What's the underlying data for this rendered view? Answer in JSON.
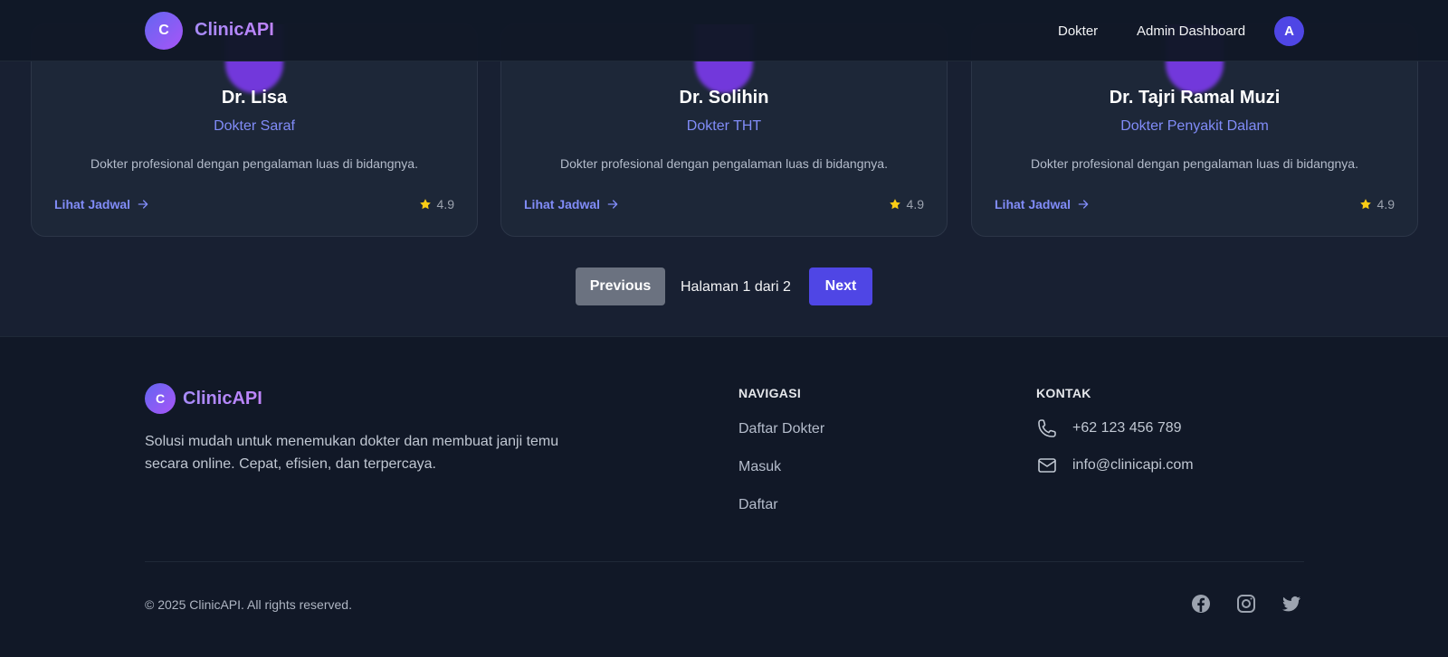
{
  "header": {
    "logo_letter": "C",
    "brand": "ClinicAPI",
    "nav": [
      "Dokter",
      "Admin Dashboard"
    ],
    "user_initial": "A"
  },
  "doctors": [
    {
      "name": "Dr. Lisa",
      "specialty": "Dokter Saraf",
      "description": "Dokter profesional dengan pengalaman luas di bidangnya.",
      "link": "Lihat Jadwal",
      "rating": "4.9"
    },
    {
      "name": "Dr. Solihin",
      "specialty": "Dokter THT",
      "description": "Dokter profesional dengan pengalaman luas di bidangnya.",
      "link": "Lihat Jadwal",
      "rating": "4.9"
    },
    {
      "name": "Dr. Tajri Ramal Muzi",
      "specialty": "Dokter Penyakit Dalam",
      "description": "Dokter profesional dengan pengalaman luas di bidangnya.",
      "link": "Lihat Jadwal",
      "rating": "4.9"
    }
  ],
  "pagination": {
    "previous": "Previous",
    "info": "Halaman 1 dari 2",
    "next": "Next"
  },
  "footer": {
    "logo_letter": "C",
    "brand": "ClinicAPI",
    "description": "Solusi mudah untuk menemukan dokter dan membuat janji temu secara online. Cepat, efisien, dan terpercaya.",
    "nav_title": "NAVIGASI",
    "nav_links": [
      "Daftar Dokter",
      "Masuk",
      "Daftar"
    ],
    "contact_title": "KONTAK",
    "phone": "+62 123 456 789",
    "email": "info@clinicapi.com",
    "copyright": "© 2025 ClinicAPI. All rights reserved.",
    "social": [
      "facebook-icon",
      "instagram-icon",
      "twitter-icon"
    ]
  },
  "colors": {
    "accent": "#4f46e5",
    "link": "#818cf8",
    "star": "#facc15",
    "background": "#111827"
  }
}
